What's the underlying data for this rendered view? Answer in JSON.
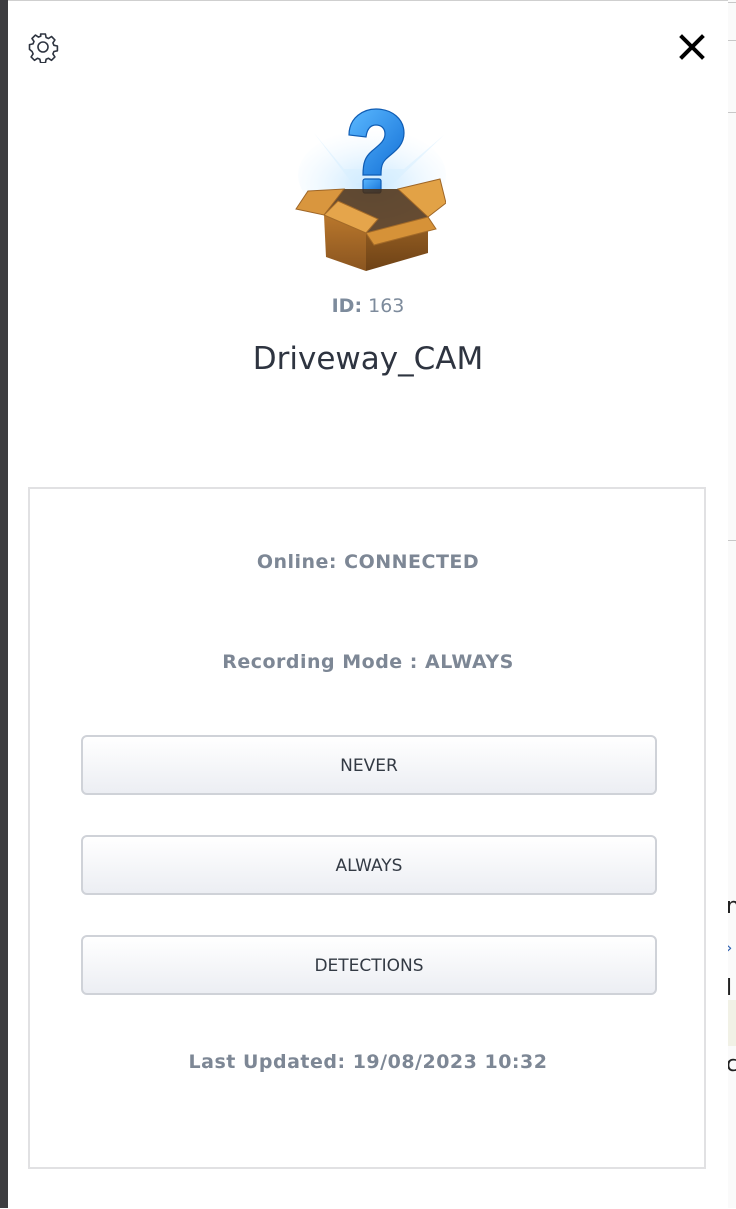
{
  "panel": {
    "device_id_label": "ID:",
    "device_id_value": "163",
    "device_name": "Driveway_CAM",
    "settings_icon": "gear-icon",
    "close_icon": "close-icon",
    "device_image": "unknown-device-box-icon"
  },
  "status": {
    "online_text": "Online: CONNECTED",
    "recording_mode_text": "Recording Mode : ALWAYS",
    "last_updated_text": "Last Updated: 19/08/2023 10:32"
  },
  "mode_buttons": [
    {
      "label": "NEVER"
    },
    {
      "label": "ALWAYS"
    },
    {
      "label": "DETECTIONS"
    }
  ],
  "colors": {
    "status_text": "#7d8795",
    "title_text": "#2e3440",
    "button_border": "#cfd2d8",
    "question_mark": "#2d8fe6",
    "box_brown": "#c98a35"
  }
}
